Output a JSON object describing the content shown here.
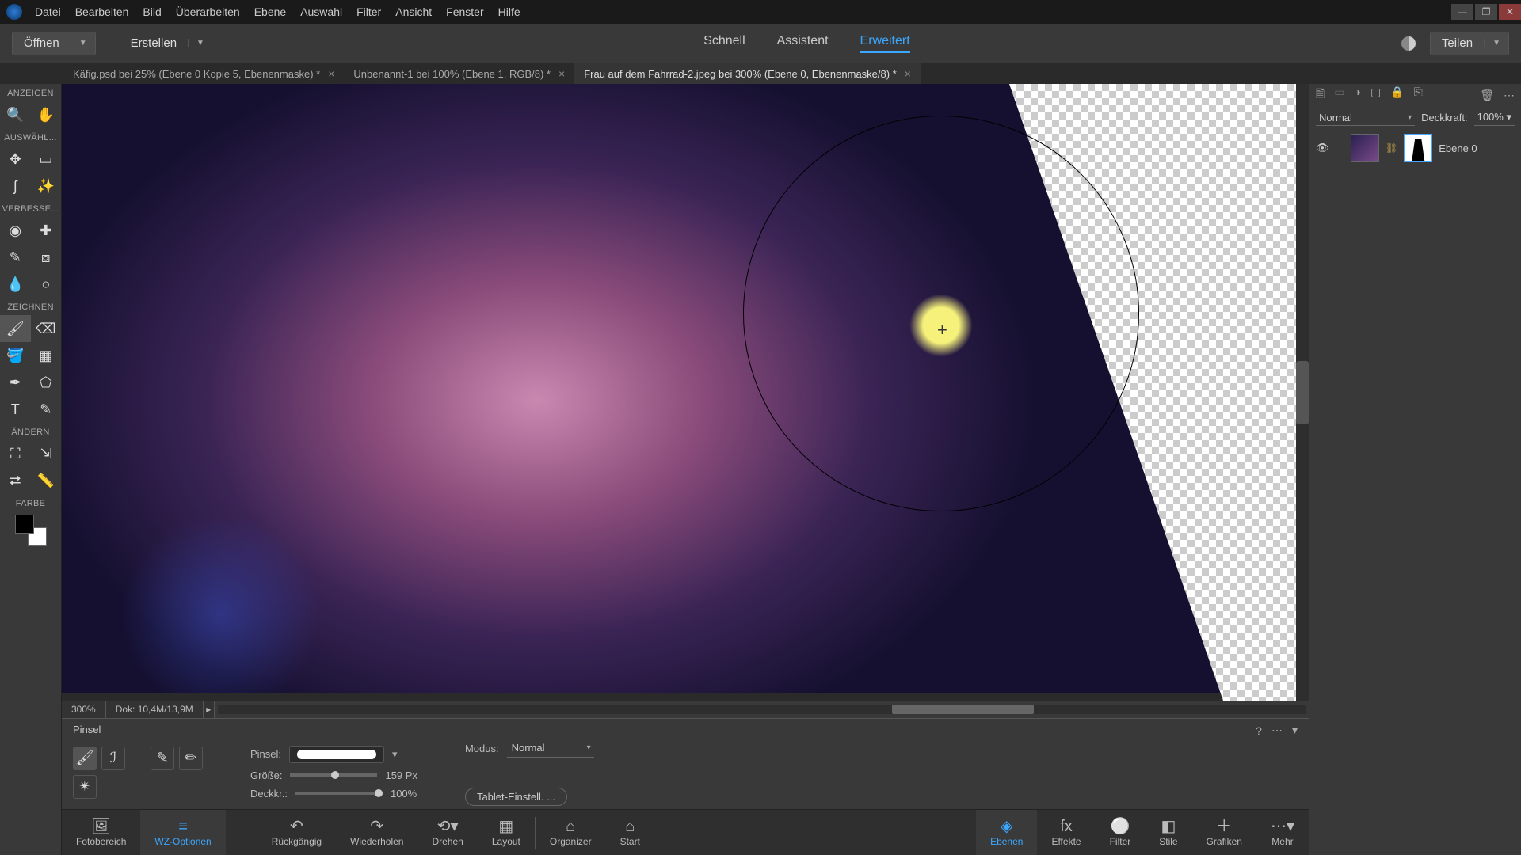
{
  "menu": [
    "Datei",
    "Bearbeiten",
    "Bild",
    "Überarbeiten",
    "Ebene",
    "Auswahl",
    "Filter",
    "Ansicht",
    "Fenster",
    "Hilfe"
  ],
  "topbar": {
    "open": "Öffnen",
    "create": "Erstellen",
    "modes": {
      "quick": "Schnell",
      "assist": "Assistent",
      "expert": "Erweitert"
    },
    "share": "Teilen"
  },
  "tabs": [
    {
      "label": "Käfig.psd bei 25% (Ebene 0 Kopie 5, Ebenenmaske) *",
      "active": false
    },
    {
      "label": "Unbenannt-1 bei 100% (Ebene 1, RGB/8) *",
      "active": false
    },
    {
      "label": "Frau auf dem Fahrrad-2.jpeg bei 300% (Ebene 0, Ebenenmaske/8) *",
      "active": true
    }
  ],
  "toolGroups": {
    "view": "ANZEIGEN",
    "select": "AUSWÄHL...",
    "enhance": "VERBESSE...",
    "draw": "ZEICHNEN",
    "modify": "ÄNDERN",
    "color": "FARBE"
  },
  "status": {
    "zoom": "300%",
    "doc": "Dok: 10,4M/13,9M"
  },
  "options": {
    "title": "Pinsel",
    "brushLabel": "Pinsel:",
    "sizeLabel": "Größe:",
    "sizeValue": "159 Px",
    "opacLabel": "Deckkr.:",
    "opacValue": "100%",
    "modeLabel": "Modus:",
    "modeValue": "Normal",
    "tablet": "Tablet-Einstell. ..."
  },
  "bottomNav": {
    "fotobereich": "Fotobereich",
    "wz": "WZ-Optionen",
    "undo": "Rückgängig",
    "redo": "Wiederholen",
    "rotate": "Drehen",
    "layout": "Layout",
    "organizer": "Organizer",
    "start": "Start",
    "ebenen": "Ebenen",
    "effekte": "Effekte",
    "filter": "Filter",
    "stile": "Stile",
    "grafiken": "Grafiken",
    "mehr": "Mehr"
  },
  "layers": {
    "blend": "Normal",
    "opacLabel": "Deckkraft:",
    "opacValue": "100%",
    "layerName": "Ebene 0"
  }
}
